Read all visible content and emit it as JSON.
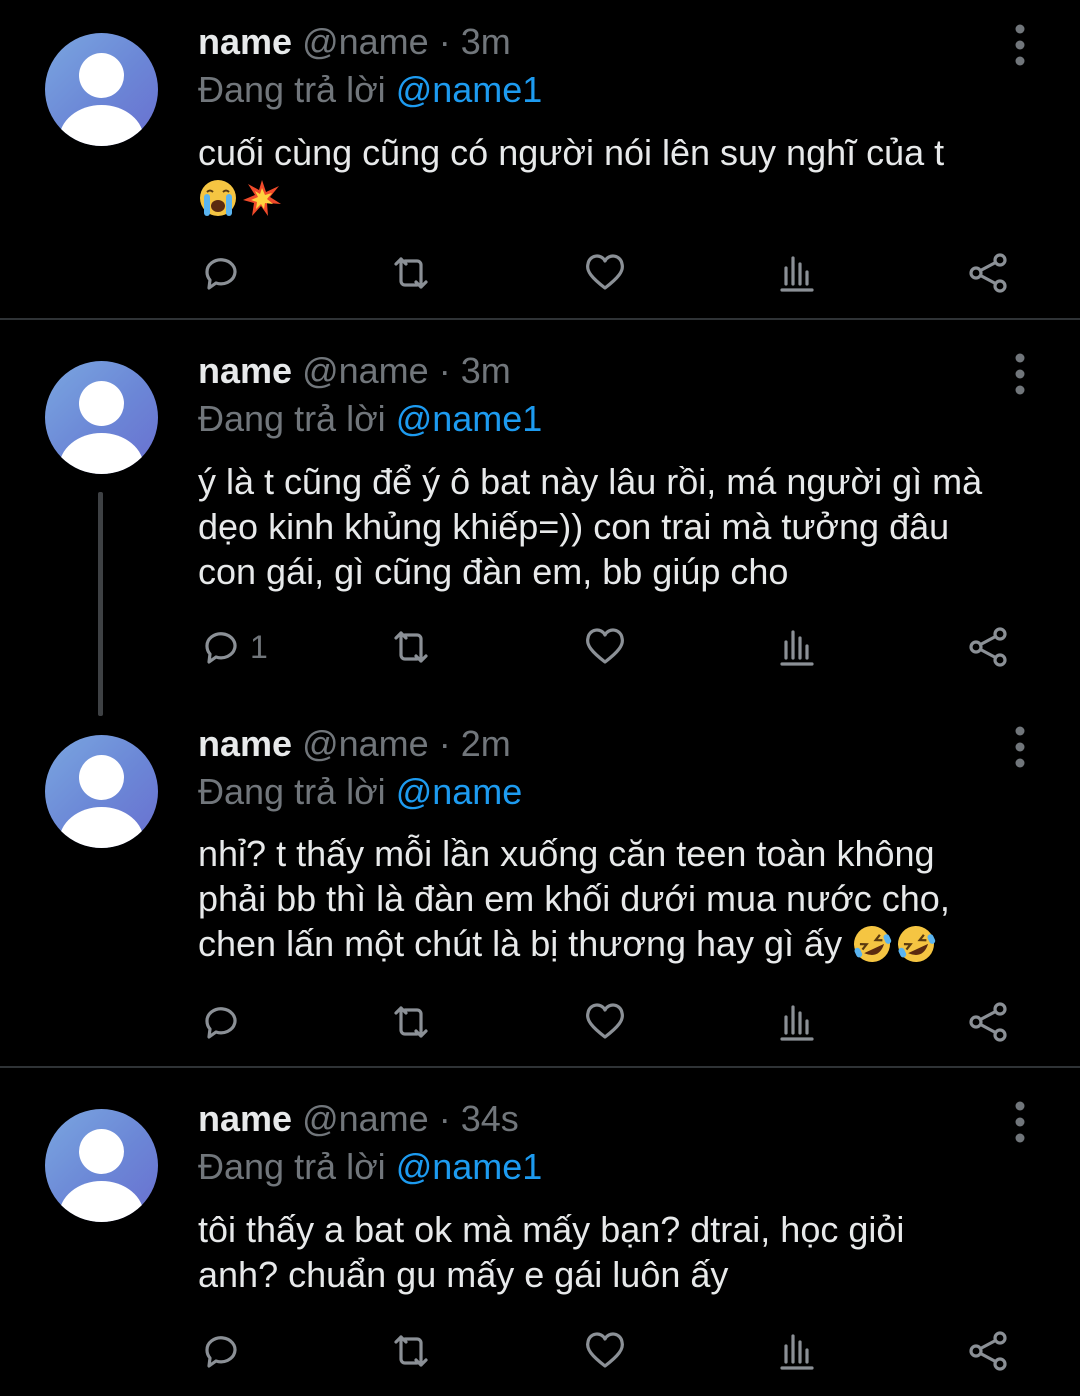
{
  "tweets": [
    {
      "name": "name",
      "handle": "@name",
      "dot": "·",
      "time": "3m",
      "reply_prefix": "Đang trả lời",
      "reply_to": "@name1",
      "lines": [
        "cuối cùng cũng có người nói lên suy nghĩ của t"
      ],
      "emoji_line": [
        "loudly-crying-face",
        "collision"
      ],
      "reply_count": ""
    },
    {
      "name": "name",
      "handle": "@name",
      "dot": "·",
      "time": "3m",
      "reply_prefix": "Đang trả lời",
      "reply_to": "@name1",
      "lines": [
        "ý là t cũng để ý ô bat này lâu rồi, má người gì mà",
        "dẹo kinh khủng khiếp=)) con trai mà tưởng đâu",
        "con gái, gì cũng đàn em, bb giúp cho"
      ],
      "reply_count": "1"
    },
    {
      "name": "name",
      "handle": "@name",
      "dot": "·",
      "time": "2m",
      "reply_prefix": "Đang trả lời",
      "reply_to": "@name",
      "lines": [
        "nhỉ? t thấy mỗi lần xuống căn teen toàn không",
        "phải bb thì là đàn em khối dưới mua nước cho,",
        "chen lấn một chút là bị thương hay gì ấy"
      ],
      "trailing_emoji": [
        "rolling-on-floor-laughing",
        "rolling-on-floor-laughing"
      ],
      "reply_count": ""
    },
    {
      "name": "name",
      "handle": "@name",
      "dot": "·",
      "time": "34s",
      "reply_prefix": "Đang trả lời",
      "reply_to": "@name1",
      "lines": [
        "tôi thấy a bat ok mà mấy bạn? dtrai, học giỏi",
        "anh? chuẩn gu mấy e gái luôn ấy"
      ],
      "reply_count": ""
    }
  ],
  "colors": {
    "background": "#000000",
    "text": "#e7e9ea",
    "muted": "#71767b",
    "mention": "#1d9bf0",
    "divider": "#2f3336",
    "avatar": "#6b86d6"
  }
}
